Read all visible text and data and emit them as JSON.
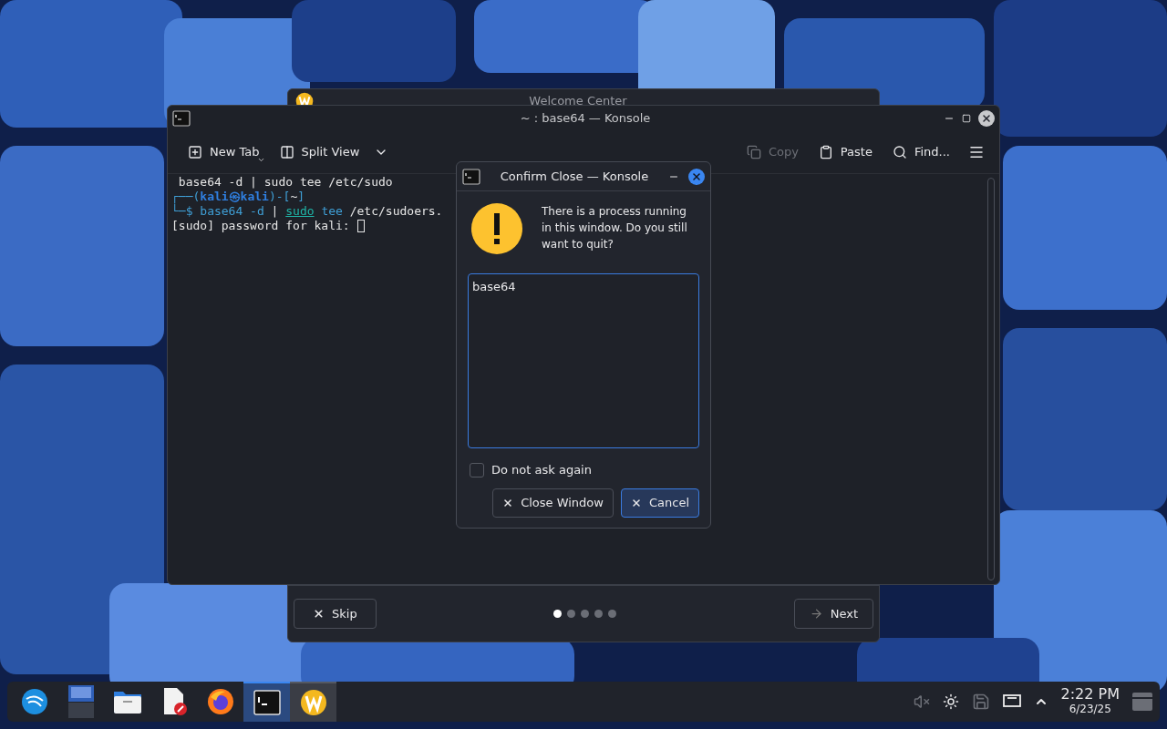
{
  "welcome_window": {
    "title": "Welcome Center",
    "pages": [
      {
        "selected": true
      },
      {
        "selected": false
      },
      {
        "selected": false
      },
      {
        "selected": false
      },
      {
        "selected": false
      }
    ],
    "skip": "Skip",
    "next": "Next"
  },
  "konsole": {
    "title": "~ : base64 — Konsole",
    "toolbar": [
      {
        "kind": "new-tab",
        "label": "New Tab",
        "disabled": false
      },
      {
        "kind": "split",
        "label": "Split View",
        "disabled": false
      },
      {
        "kind": "copy",
        "label": "Copy",
        "disabled": true
      },
      {
        "kind": "paste",
        "label": "Paste",
        "disabled": false
      },
      {
        "kind": "find",
        "label": "Find...",
        "disabled": false
      }
    ],
    "lines": [
      [
        {
          "text": " base64 -d | sudo tee /etc/sudo",
          "kind": "plain"
        }
      ],
      [
        {
          "text": "┌──(",
          "kind": "frame"
        },
        {
          "text": "kali㉿kali",
          "kind": "user"
        },
        {
          "text": ")-[",
          "kind": "frame"
        },
        {
          "text": "~",
          "kind": "plain"
        },
        {
          "text": "]",
          "kind": "frame"
        }
      ],
      [
        {
          "text": "└─$ ",
          "kind": "frame"
        },
        {
          "text": "base64 -d ",
          "kind": "command"
        },
        {
          "text": "| ",
          "kind": "plain"
        },
        {
          "text": "sudo",
          "kind": "builtin"
        },
        {
          "text": " tee ",
          "kind": "command"
        },
        {
          "text": "/etc/sudoers.",
          "kind": "plain"
        }
      ],
      [
        {
          "text": "[sudo] password for kali: ",
          "kind": "plain"
        }
      ]
    ],
    "cursor": true
  },
  "dialog": {
    "title": "Confirm Close — Konsole",
    "message": "There is a process running in this window. Do you still want to quit?",
    "processes": "base64",
    "checkbox": {
      "label": "Do not ask again",
      "checked": false
    },
    "buttons": [
      {
        "label": "Close Window",
        "default": false
      },
      {
        "label": "Cancel",
        "default": true
      }
    ]
  },
  "taskbar": {
    "apps": [
      {
        "kind": "kali",
        "active": false,
        "open": false
      },
      {
        "kind": "pager",
        "active": false,
        "open": false
      },
      {
        "kind": "files",
        "active": false,
        "open": false
      },
      {
        "kind": "editor",
        "active": false,
        "open": false
      },
      {
        "kind": "firefox",
        "active": false,
        "open": false
      },
      {
        "kind": "terminal",
        "active": true,
        "open": true
      },
      {
        "kind": "welcome",
        "active": false,
        "open": true
      }
    ],
    "time": "2:22 PM",
    "date": "6/23/25"
  }
}
